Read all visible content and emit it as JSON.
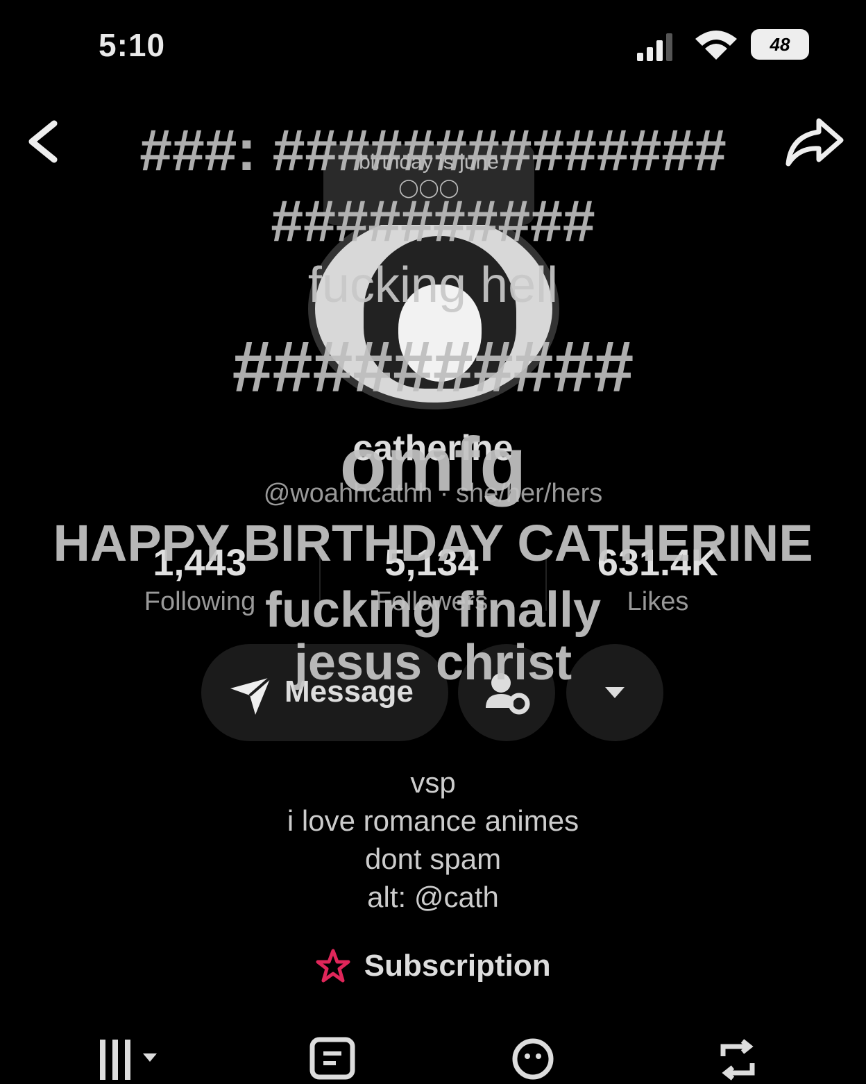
{
  "status_bar": {
    "time": "5:10",
    "battery": "48"
  },
  "profile": {
    "note": "birthday is june",
    "name": "catherine",
    "handle": "@woahhcathh · she/her/hers",
    "stats": [
      {
        "value": "1,443",
        "label": "Following"
      },
      {
        "value": "5,134",
        "label": "Followers"
      },
      {
        "value": "631.4K",
        "label": "Likes"
      }
    ],
    "message_label": "Message",
    "bio": [
      "vsp",
      "i love romance animes",
      "dont spam",
      "alt: @cath"
    ],
    "subscription_label": "Subscription"
  },
  "overlay": {
    "line1": "###: ##############",
    "line2": "##########",
    "line3": "fucking hell",
    "line4": "##########",
    "line5": "omfg",
    "line6": "HAPPY BIRTHDAY CATHERINE",
    "line7": "fucking finally",
    "line8": "jesus christ"
  },
  "colors": {
    "subscription_icon": "#e0265a",
    "background": "#000000"
  }
}
